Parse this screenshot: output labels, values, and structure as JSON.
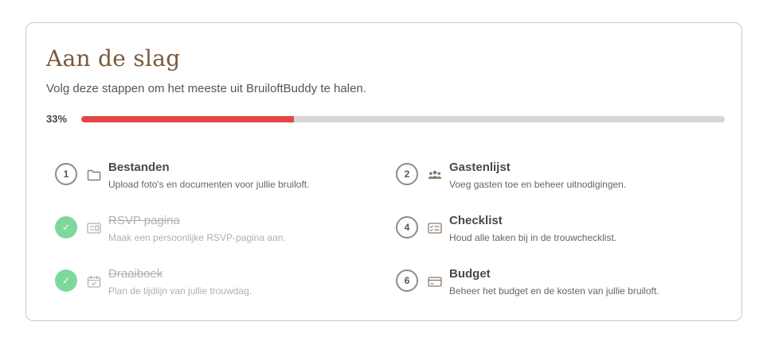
{
  "card": {
    "title": "Aan de slag",
    "subtitle": "Volg deze stappen om het meeste uit BruiloftBuddy te halen."
  },
  "progress": {
    "label": "33%",
    "fraction": 0.33,
    "fill_color": "#e04848",
    "track_color": "#d6d6d6"
  },
  "colors": {
    "title": "#7a5a38",
    "done_badge": "#7dd99b",
    "icon": "#8a7a6a"
  },
  "steps": [
    {
      "badge": "1",
      "done": false,
      "icon": "folder-icon",
      "title": "Bestanden",
      "description": "Upload foto's en documenten voor jullie bruiloft."
    },
    {
      "badge": "2",
      "done": false,
      "icon": "people-icon",
      "title": "Gastenlijst",
      "description": "Voeg gasten toe en beheer uitnodigingen."
    },
    {
      "badge": "✓",
      "done": true,
      "icon": "id-card-icon",
      "title": "RSVP pagina",
      "description": "Maak een persoonlijke RSVP-pagina aan."
    },
    {
      "badge": "4",
      "done": false,
      "icon": "checklist-icon",
      "title": "Checklist",
      "description": "Houd alle taken bij in de trouwchecklist."
    },
    {
      "badge": "✓",
      "done": true,
      "icon": "calendar-check-icon",
      "title": "Draaiboek",
      "description": "Plan de tijdlijn van jullie trouwdag."
    },
    {
      "badge": "6",
      "done": false,
      "icon": "credit-card-icon",
      "title": "Budget",
      "description": "Beheer het budget en de kosten van jullie bruiloft."
    }
  ]
}
